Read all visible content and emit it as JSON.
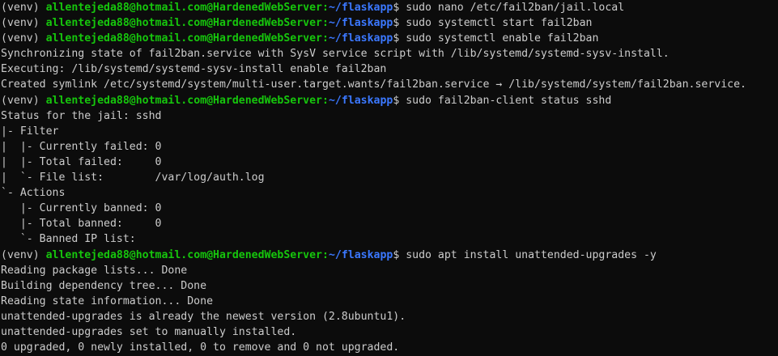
{
  "colors": {
    "background": "#0c0c0c",
    "foreground": "#cccccc",
    "user_host": "#16c60c",
    "path": "#3b78ff"
  },
  "prompt": {
    "venv": "(venv) ",
    "user_host": "allentejeda88@hotmail.com@HardenedWebServer",
    "separator": ":",
    "path": "~/flaskapp",
    "symbol": "$ "
  },
  "lines": [
    {
      "type": "prompt",
      "command": "sudo nano /etc/fail2ban/jail.local"
    },
    {
      "type": "prompt",
      "command": "sudo systemctl start fail2ban"
    },
    {
      "type": "prompt",
      "command": "sudo systemctl enable fail2ban"
    },
    {
      "type": "output",
      "text": "Synchronizing state of fail2ban.service with SysV service script with /lib/systemd/systemd-sysv-install."
    },
    {
      "type": "output",
      "text": "Executing: /lib/systemd/systemd-sysv-install enable fail2ban"
    },
    {
      "type": "output",
      "text": "Created symlink /etc/systemd/system/multi-user.target.wants/fail2ban.service → /lib/systemd/system/fail2ban.service."
    },
    {
      "type": "prompt",
      "command": "sudo fail2ban-client status sshd"
    },
    {
      "type": "output",
      "text": "Status for the jail: sshd"
    },
    {
      "type": "output",
      "text": "|- Filter"
    },
    {
      "type": "output",
      "text": "|  |- Currently failed: 0"
    },
    {
      "type": "output",
      "text": "|  |- Total failed:     0"
    },
    {
      "type": "output",
      "text": "|  `- File list:        /var/log/auth.log"
    },
    {
      "type": "output",
      "text": "`- Actions"
    },
    {
      "type": "output",
      "text": "   |- Currently banned: 0"
    },
    {
      "type": "output",
      "text": "   |- Total banned:     0"
    },
    {
      "type": "output",
      "text": "   `- Banned IP list:"
    },
    {
      "type": "prompt",
      "command": "sudo apt install unattended-upgrades -y"
    },
    {
      "type": "output",
      "text": "Reading package lists... Done"
    },
    {
      "type": "output",
      "text": "Building dependency tree... Done"
    },
    {
      "type": "output",
      "text": "Reading state information... Done"
    },
    {
      "type": "output",
      "text": "unattended-upgrades is already the newest version (2.8ubuntu1)."
    },
    {
      "type": "output",
      "text": "unattended-upgrades set to manually installed."
    },
    {
      "type": "output",
      "text": "0 upgraded, 0 newly installed, 0 to remove and 0 not upgraded."
    }
  ]
}
